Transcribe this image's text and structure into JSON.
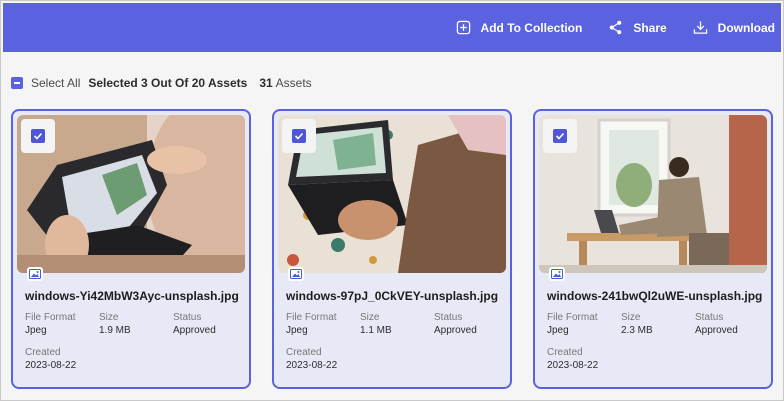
{
  "toolbar": {
    "add_to_collection": "Add To Collection",
    "share": "Share",
    "download": "Download"
  },
  "selection": {
    "select_all": "Select All",
    "selected_text": "Selected 3 Out Of 20 Assets",
    "total_count": "31",
    "total_label": "Assets"
  },
  "labels": {
    "file_format": "File Format",
    "size": "Size",
    "status": "Status",
    "created": "Created"
  },
  "cards": [
    {
      "filename": "windows-Yi42MbW3Ayc-unsplash.jpg",
      "format": "Jpeg",
      "size": "1.9 MB",
      "status": "Approved",
      "created": "2023-08-22"
    },
    {
      "filename": "windows-97pJ_0CkVEY-unsplash.jpg",
      "format": "Jpeg",
      "size": "1.1 MB",
      "status": "Approved",
      "created": "2023-08-22"
    },
    {
      "filename": "windows-241bwQl2uWE-unsplash.jpg",
      "format": "Jpeg",
      "size": "2.3 MB",
      "status": "Approved",
      "created": "2023-08-22"
    }
  ],
  "colors": {
    "accent": "#5a62e0",
    "card_bg": "#e8e9f7"
  }
}
